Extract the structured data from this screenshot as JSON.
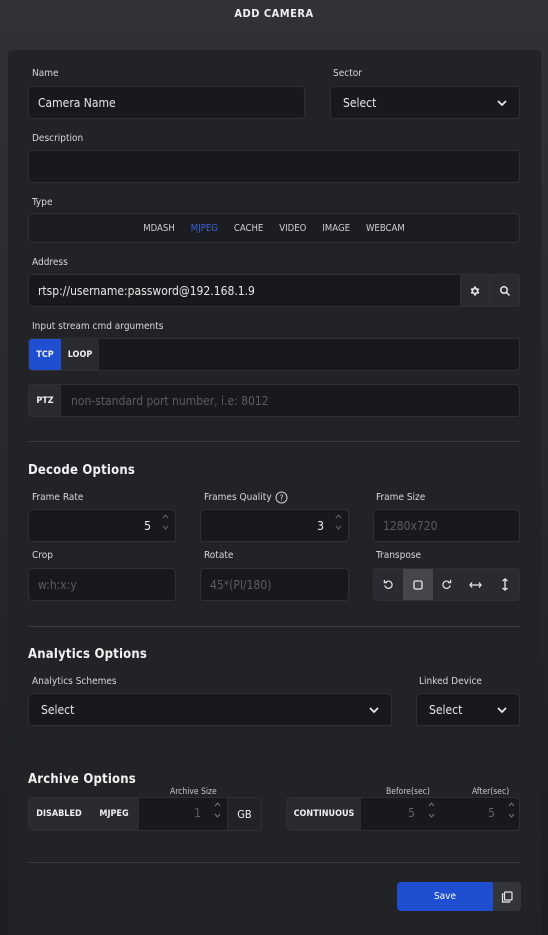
{
  "header": {
    "title": "ADD CAMERA"
  },
  "general": {
    "name_label": "Name",
    "name_value": "Camera Name",
    "sector_label": "Sector",
    "sector_value": "Select",
    "description_label": "Description",
    "description_value": "",
    "type_label": "Type",
    "type_tabs": [
      "MDASH",
      "MJPEG",
      "CACHE",
      "VIDEO",
      "IMAGE",
      "WEBCAM"
    ],
    "type_selected": "MJPEG",
    "address_label": "Address",
    "address_value": "rtsp://username:password@192.168.1.9",
    "input_args_label": "Input stream cmd arguments",
    "tcp_label": "TCP",
    "loop_label": "LOOP",
    "input_args_value": "",
    "ptz_label": "PTZ",
    "ptz_placeholder": "non-standard port number, i.e: 8012"
  },
  "decode": {
    "title": "Decode Options",
    "frame_rate_label": "Frame Rate",
    "frame_rate_value": "5",
    "frames_quality_label": "Frames Quality",
    "frames_quality_value": "3",
    "frame_size_label": "Frame Size",
    "frame_size_placeholder": "1280x720",
    "crop_label": "Crop",
    "crop_placeholder": "w:h:x:y",
    "rotate_label": "Rotate",
    "rotate_placeholder": "45*(PI/180)",
    "transpose_label": "Transpose",
    "transpose_icons": [
      "rotate-ccw-icon",
      "square-icon",
      "rotate-cw-icon",
      "flip-horizontal-icon",
      "flip-vertical-icon"
    ],
    "transpose_selected": "square-icon"
  },
  "analytics": {
    "title": "Analytics Options",
    "schemes_label": "Analytics Schemes",
    "schemes_value": "Select",
    "linked_label": "Linked Device",
    "linked_value": "Select"
  },
  "archive": {
    "title": "Archive Options",
    "disabled_label": "DISABLED",
    "mjpeg_label": "MJPEG",
    "size_label": "Archive Size",
    "size_value": "1",
    "size_unit": "GB",
    "continuous_label": "CONTINUOUS",
    "before_label": "Before(sec)",
    "before_value": "5",
    "after_label": "After(sec)",
    "after_value": "5"
  },
  "footer": {
    "save_label": "Save"
  },
  "colors": {
    "accent": "#1f4fd0",
    "active_tab": "#3a63d8",
    "panel": "#222327",
    "field": "#18191c"
  }
}
